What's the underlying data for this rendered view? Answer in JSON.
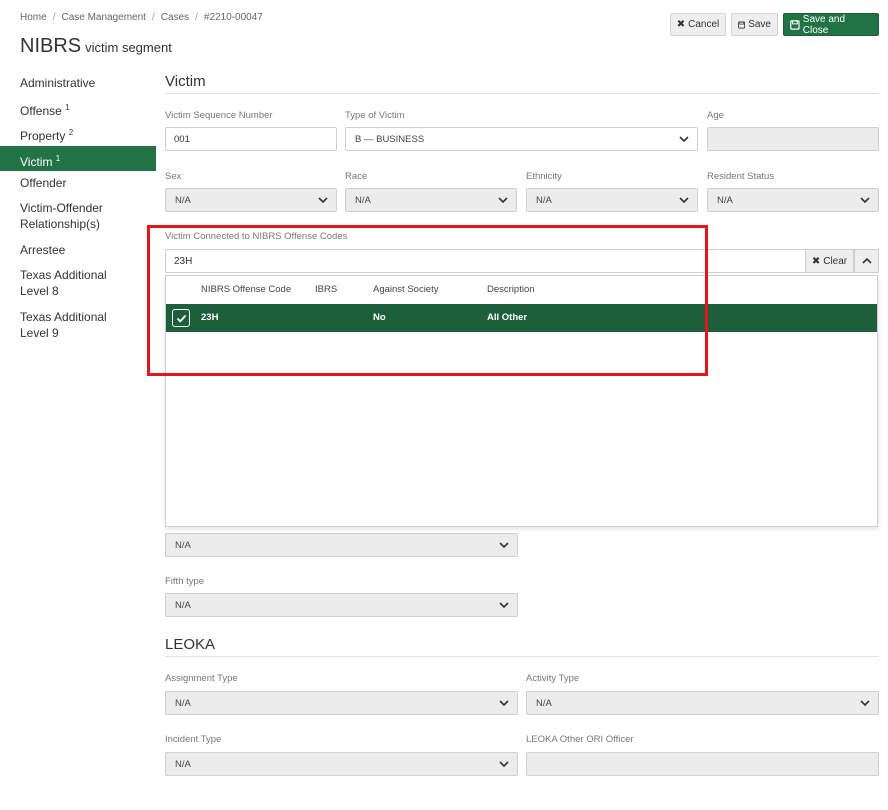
{
  "breadcrumb": [
    "Home",
    "Case Management",
    "Cases",
    "#2210-00047"
  ],
  "page": {
    "title": "NIBRS",
    "subtitle": "victim segment"
  },
  "toolbar": {
    "cancel": "Cancel",
    "save": "Save",
    "save_close": "Save and Close"
  },
  "nav": [
    {
      "label": "Administrative",
      "sup": ""
    },
    {
      "label": "Offense",
      "sup": "1"
    },
    {
      "label": "Property",
      "sup": "2"
    },
    {
      "label": "Victim",
      "sup": "1"
    },
    {
      "label": "Offender",
      "sup": ""
    },
    {
      "label": "Victim-Offender Relationship(s)",
      "sup": ""
    },
    {
      "label": "Arrestee",
      "sup": ""
    },
    {
      "label": "Texas Additional Level 8",
      "sup": ""
    },
    {
      "label": "Texas Additional Level 9",
      "sup": ""
    }
  ],
  "victim": {
    "heading": "Victim",
    "seq_label": "Victim Sequence Number",
    "seq_value": "001",
    "type_label": "Type of Victim",
    "type_value": "B — BUSINESS",
    "age_label": "Age",
    "sex_label": "Sex",
    "sex_value": "N/A",
    "race_label": "Race",
    "race_value": "N/A",
    "ethnicity_label": "Ethnicity",
    "ethnicity_value": "N/A",
    "resident_label": "Resident Status",
    "resident_value": "N/A",
    "offense_codes_label": "Victim Connected to NIBRS Offense Codes",
    "offense_codes_value": "23H",
    "clear": "Clear"
  },
  "dropdown": {
    "columns": [
      "NIBRS Offense Code",
      "IBRS",
      "Against Society",
      "Description"
    ],
    "rows": [
      {
        "code": "23H",
        "ibrs": "",
        "against_society": "No",
        "description": "All Other",
        "selected": true
      }
    ]
  },
  "injury": {
    "fourth_value": "N/A",
    "fifth_label": "Fifth type",
    "fifth_value": "N/A"
  },
  "leoka": {
    "heading": "LEOKA",
    "assignment_label": "Assignment Type",
    "assignment_value": "N/A",
    "activity_label": "Activity Type",
    "activity_value": "N/A",
    "incident_label": "Incident Type",
    "incident_value": "N/A",
    "ori_label": "LEOKA Other ORI Officer"
  },
  "colors": {
    "accent": "#217346",
    "selected_row": "#1d5e3b",
    "highlight": "#e4161b"
  }
}
